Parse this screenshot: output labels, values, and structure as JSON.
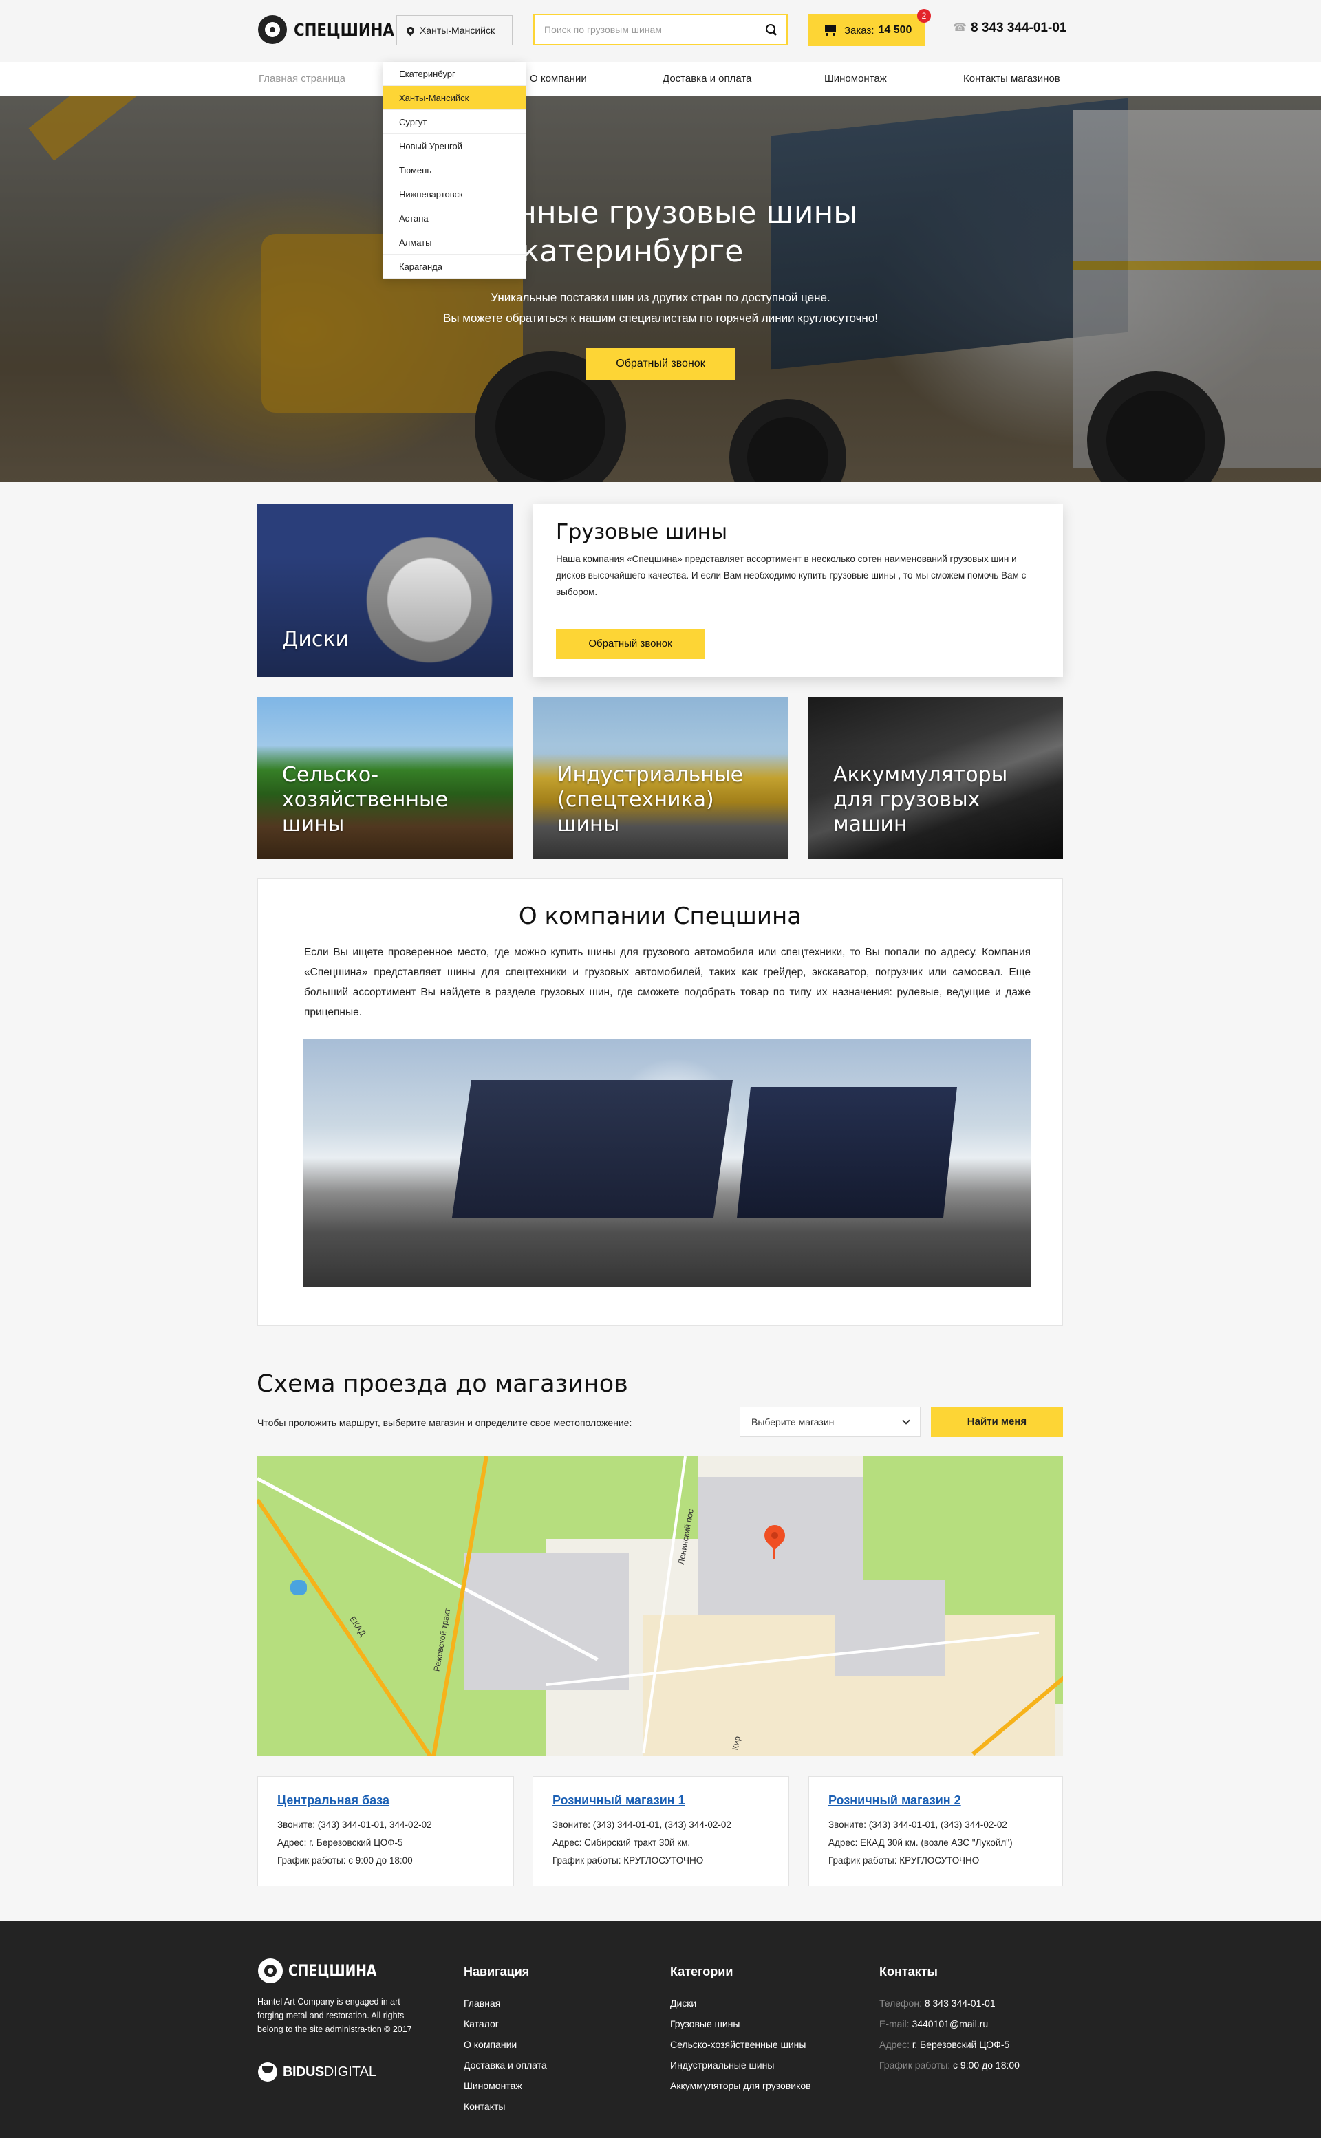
{
  "header": {
    "logo_text": "СПЕЦШИНА",
    "city": "Ханты-Мансийск",
    "search_placeholder": "Поиск по грузовым шинам",
    "cart_label": "Заказ:",
    "cart_amount": "14 500",
    "cart_count": "2",
    "phone": "8 343 344-01-01"
  },
  "nav": {
    "items": [
      "Главная страница",
      "О компании",
      "Доставка и оплата",
      "Шиномонтаж",
      "Контакты магазинов"
    ]
  },
  "city_dropdown": {
    "options": [
      "Екатеринбург",
      "Ханты-Мансийск",
      "Сургут",
      "Новый Уренгой",
      "Тюмень",
      "Нижневартовск",
      "Астана",
      "Алматы",
      "Караганда"
    ],
    "selected": "Ханты-Мансийск"
  },
  "hero": {
    "title_line1": "енные грузовые шины",
    "title_line2": "в Екатеринбурге",
    "sub_line1": "Уникальные поставки шин из других стран по доступной цене.",
    "sub_line2": "Вы можете обратиться к нашим специалистам по горячей линии круглосуточно!",
    "button": "Обратный звонок"
  },
  "categories": {
    "disks": "Диски",
    "agri": "Сельско-хозяйственные шины",
    "industrial": "Индустриальные (спецтехника) шины",
    "batteries": "Аккуммуляторы для грузовых машин"
  },
  "feature": {
    "title": "Грузовые шины",
    "text": "Наша компания «Спецшина» представляет ассортимент в несколько сотен наименований грузовых шин и дисков высочайшего качества. И если Вам необходимо купить грузовые шины , то мы сможем помочь Вам с выбором.",
    "button": "Обратный звонок"
  },
  "about": {
    "title": "О компании Спецшина",
    "text": "Если Вы ищете проверенное место, где можно купить шины для грузового автомобиля или спецтехники, то Вы попали по адресу. Компания «Спецшина» представляет шины для спецтехники и грузовых автомобилей, таких как грейдер, экскаватор, погрузчик или самосвал. Еще больший ассортимент Вы найдете в разделе грузовых шин, где сможете подобрать товар по типу их назначения: рулевые, ведущие и даже прицепные."
  },
  "route": {
    "title": "Схема проезда до магазинов",
    "hint": "Чтобы проложить маршрут, выберите магазин и определите свое местоположение:",
    "select_value": "Выберите магазин",
    "find_button": "Найти меня",
    "map_labels": {
      "ekad": "ЕКАД",
      "rezh": "Режевской тракт",
      "lenin": "Ленинский пос",
      "kir": "Кир"
    }
  },
  "stores": [
    {
      "name": "Центральная база",
      "phone": "Звоните: (343) 344-01-01, 344-02-02",
      "address": "Адрес: г. Березовский ЦОФ-5",
      "hours": "График работы: с 9:00 до 18:00"
    },
    {
      "name": "Розничный магазин 1",
      "phone": "Звоните: (343) 344-01-01, (343) 344-02-02",
      "address": "Адрес: Сибирский тракт 30й км.",
      "hours": "График работы: КРУГЛОСУТОЧНО"
    },
    {
      "name": "Розничный магазин 2",
      "phone": "Звоните: (343) 344-01-01, (343) 344-02-02",
      "address": "Адрес: ЕКАД 30й км. (возле АЗС \"Лукойл\")",
      "hours": "График работы: КРУГЛОСУТОЧНО"
    }
  ],
  "footer": {
    "logo_text": "СПЕЦШИНА",
    "about": "Hantel Art Company is engaged in art forging metal and restoration. All rights belong to the site administra-tion © 2017",
    "dev_bold": "BIDUS",
    "dev_light": "DIGITAL",
    "nav_title": "Навигация",
    "nav_items": [
      "Главная",
      "Каталог",
      "О компании",
      "Доставка и оплата",
      "Шиномонтаж",
      "Контакты"
    ],
    "cat_title": "Категории",
    "cat_items": [
      "Диски",
      "Грузовые шины",
      "Сельско-хозяйственные шины",
      "Индустриальные шины",
      "Аккуммуляторы для грузовиков"
    ],
    "contacts_title": "Контакты",
    "contacts": [
      {
        "key": "Телефон:",
        "value": "8 343 344-01-01"
      },
      {
        "key": "E-mail:",
        "value": "3440101@mail.ru"
      },
      {
        "key": "Адрес:",
        "value": "г. Березовский ЦОФ-5"
      },
      {
        "key": "График работы:",
        "value": "с 9:00 до 18:00"
      }
    ]
  },
  "colors": {
    "accent": "#fdd535",
    "badge": "#e3242b",
    "link": "#1a5fb4",
    "footer_bg": "#232323",
    "map_marker": "#f04f23"
  },
  "icons": [
    "pin-icon",
    "search-icon",
    "cart-icon",
    "phone-icon",
    "chevron-down-icon",
    "map-marker-icon",
    "logo-wheel-icon"
  ]
}
